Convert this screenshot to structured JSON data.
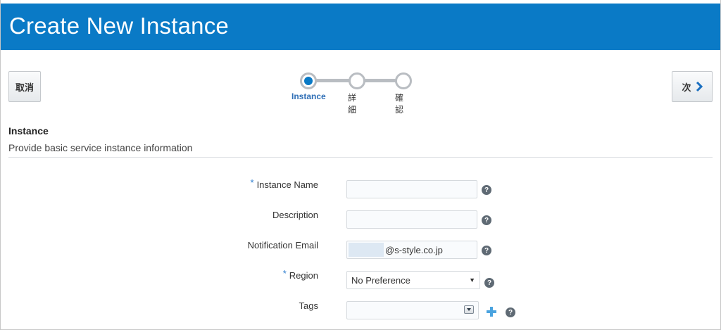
{
  "page": {
    "title": "Create New Instance"
  },
  "toolbar": {
    "cancel_label": "取消",
    "next_label": "次"
  },
  "train": {
    "steps": [
      {
        "label": "Instance",
        "active": true
      },
      {
        "label": "詳細",
        "active": false
      },
      {
        "label": "確認",
        "active": false
      }
    ]
  },
  "section": {
    "title": "Instance",
    "subtitle": "Provide basic service instance information"
  },
  "form": {
    "required_mark": "*",
    "help_glyph": "?",
    "instance_name": {
      "label": "Instance Name",
      "required": true,
      "value": ""
    },
    "description": {
      "label": "Description",
      "required": false,
      "value": ""
    },
    "notification_email": {
      "label": "Notification Email",
      "required": false,
      "value": "@s-style.co.jp"
    },
    "region": {
      "label": "Region",
      "required": true,
      "value": "No Preference"
    },
    "tags": {
      "label": "Tags",
      "required": false,
      "value": ""
    }
  },
  "icons": {
    "next": "chevron-right-icon",
    "help": "help-icon",
    "add": "plus-icon",
    "dropdown": "chevron-down-icon"
  },
  "colors": {
    "header_bg": "#0a7ac6",
    "active_step": "#2f6fb6",
    "required": "#2f7fcf",
    "add_icon": "#4aa3df"
  }
}
